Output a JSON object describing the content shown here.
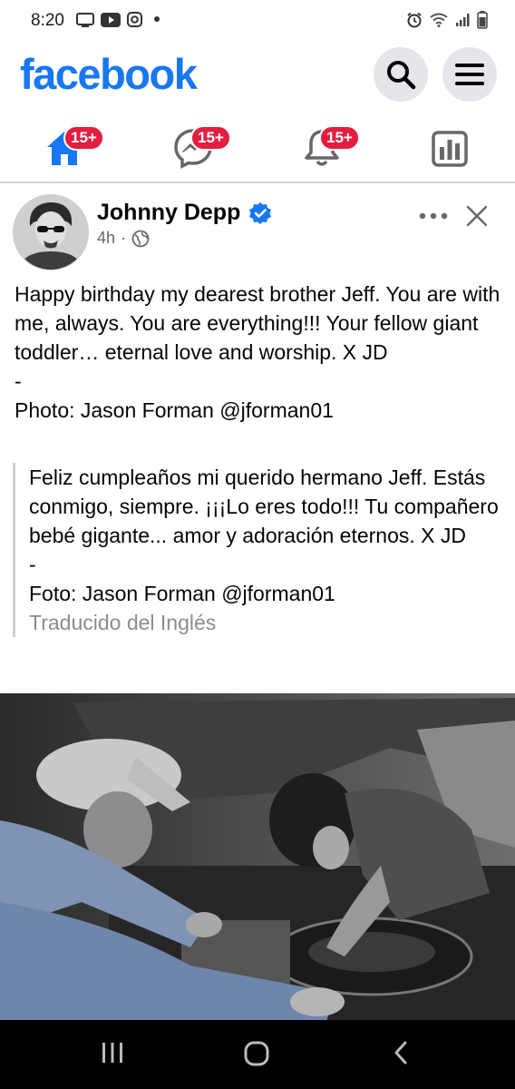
{
  "status_bar": {
    "time": "8:20"
  },
  "header": {
    "logo": "facebook"
  },
  "nav": {
    "home_badge": "15+",
    "messenger_badge": "15+",
    "notifications_badge": "15+"
  },
  "post": {
    "author": "Johnny Depp",
    "time": "4h",
    "separator": "·",
    "text_lines": [
      "Happy birthday my dearest brother Jeff. You are with me, always. You are everything!!! Your fellow giant toddler… eternal love and worship. X JD",
      "-",
      "Photo: Jason Forman @jforman01"
    ],
    "translation_lines": [
      "Feliz cumpleaños mi querido hermano Jeff. Estás conmigo, siempre. ¡¡¡Lo eres todo!!! Tu compañero bebé gigante... amor y adoración eternos. X JD",
      "-",
      "Foto: Jason Forman @jforman01"
    ],
    "translated_note": "Traducido del Inglés"
  },
  "colors": {
    "brand": "#1877f2",
    "badge": "#e41e3f",
    "secondary_text": "#65676b"
  }
}
